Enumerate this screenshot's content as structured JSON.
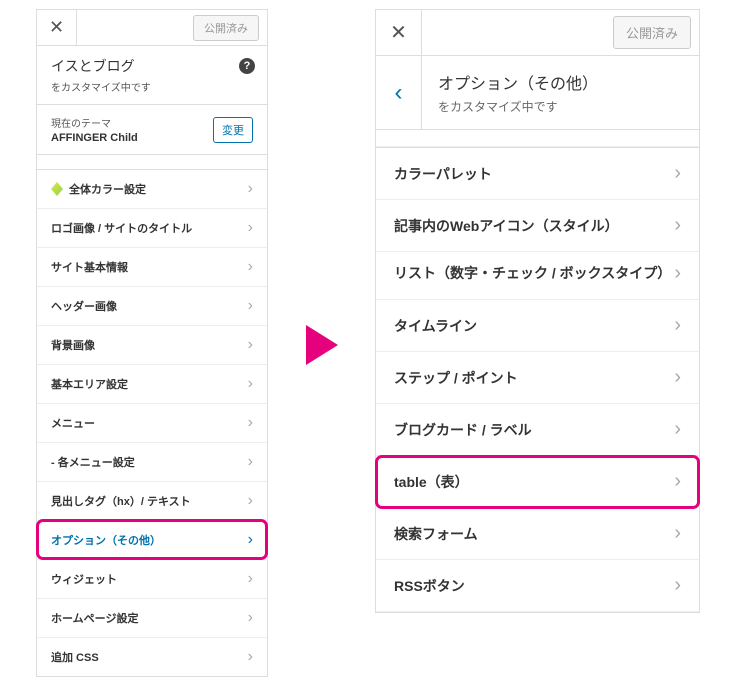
{
  "left": {
    "publish_label": "公開済み",
    "site_title": "イスとブログ",
    "customize_sub": "をカスタマイズ中です",
    "theme_label": "現在のテーマ",
    "theme_name": "AFFINGER Child",
    "change_label": "変更",
    "items": [
      {
        "label": "全体カラー設定",
        "icon": true
      },
      {
        "label": "ロゴ画像 / サイトのタイトル"
      },
      {
        "label": "サイト基本情報"
      },
      {
        "label": "ヘッダー画像"
      },
      {
        "label": "背景画像"
      },
      {
        "label": "基本エリア設定"
      },
      {
        "label": "メニュー"
      },
      {
        "label": "- 各メニュー設定"
      },
      {
        "label": "見出しタグ（hx）/ テキスト"
      },
      {
        "label": "オプション（その他）",
        "highlighted": true
      },
      {
        "label": "ウィジェット"
      },
      {
        "label": "ホームページ設定"
      },
      {
        "label": "追加 CSS"
      }
    ]
  },
  "right": {
    "publish_label": "公開済み",
    "title": "オプション（その他）",
    "customize_sub": "をカスタマイズ中です",
    "items": [
      {
        "label": "カラーパレット"
      },
      {
        "label": "記事内のWebアイコン（スタイル）"
      },
      {
        "label": "リスト（数字・チェック / ボックスタイプ）",
        "multi": true
      },
      {
        "label": "タイムライン"
      },
      {
        "label": "ステップ / ポイント"
      },
      {
        "label": "ブログカード / ラベル"
      },
      {
        "label": "table（表）",
        "highlighted": true
      },
      {
        "label": "検索フォーム"
      },
      {
        "label": "RSSボタン"
      }
    ]
  }
}
